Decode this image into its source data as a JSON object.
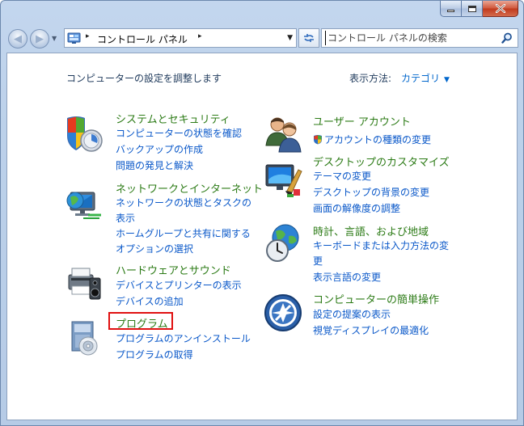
{
  "window": {
    "controls": {
      "minimize": "minimize",
      "maximize": "maximize",
      "close": "close"
    }
  },
  "nav": {
    "address": {
      "root_separator": "▸",
      "path": "コントロール パネル",
      "path_separator": "▸"
    },
    "search": {
      "placeholder": "コントロール パネルの検索"
    }
  },
  "header": {
    "title": "コンピューターの設定を調整します",
    "view_label": "表示方法:",
    "view_value": "カテゴリ"
  },
  "categories": {
    "system": {
      "title": "システムとセキュリティ",
      "links": [
        "コンピューターの状態を確認",
        "バックアップの作成",
        "問題の発見と解決"
      ]
    },
    "network": {
      "title": "ネットワークとインターネット",
      "links": [
        "ネットワークの状態とタスクの",
        "表示",
        "ホームグループと共有に関する",
        "オプションの選択"
      ]
    },
    "hardware": {
      "title": "ハードウェアとサウンド",
      "links": [
        "デバイスとプリンターの表示",
        "デバイスの追加"
      ]
    },
    "programs": {
      "title": "プログラム",
      "links": [
        "プログラムのアンインストール",
        "プログラムの取得"
      ]
    },
    "users": {
      "title": "ユーザー アカウント",
      "links": [
        "アカウントの種類の変更"
      ]
    },
    "appearance": {
      "title": "デスクトップのカスタマイズ",
      "links": [
        "テーマの変更",
        "デスクトップの背景の変更",
        "画面の解像度の調整"
      ]
    },
    "clock": {
      "title": "時計、言語、および地域",
      "links": [
        "キーボードまたは入力方法の変",
        "更",
        "表示言語の変更"
      ]
    },
    "ease": {
      "title": "コンピューターの簡単操作",
      "links": [
        "設定の提案の表示",
        "視覚ディスプレイの最適化"
      ]
    }
  },
  "colors": {
    "category_title": "#2c7b16",
    "link": "#0a58c9",
    "highlight_box": "#e01010"
  }
}
